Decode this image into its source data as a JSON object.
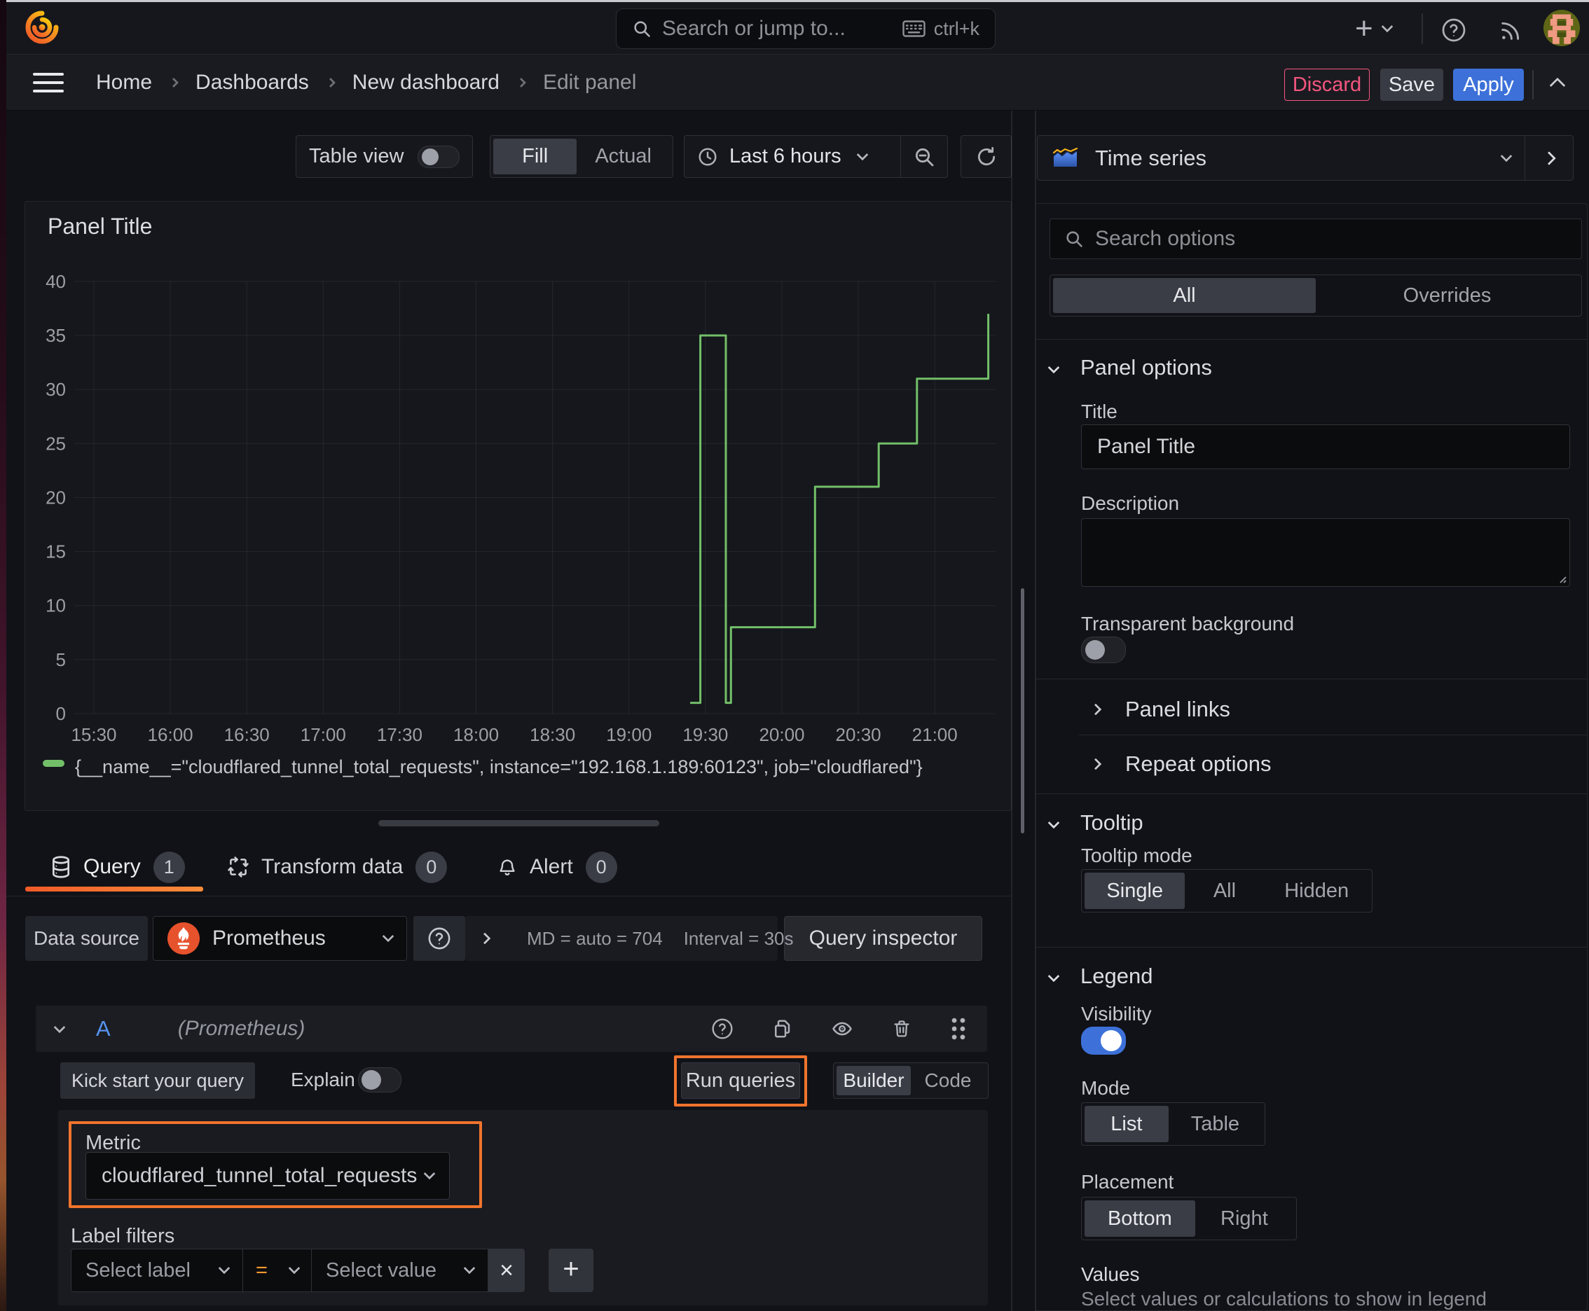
{
  "nav": {
    "search_placeholder": "Search or jump to...",
    "shortcut": "ctrl+k",
    "plus": "+"
  },
  "breadcrumb": {
    "items": [
      "Home",
      "Dashboards",
      "New dashboard",
      "Edit panel"
    ],
    "discard": "Discard",
    "save": "Save",
    "apply": "Apply"
  },
  "toolbar": {
    "table_view": "Table view",
    "fill": "Fill",
    "actual": "Actual",
    "time_range": "Last 6 hours"
  },
  "panel": {
    "title": "Panel Title"
  },
  "chart_data": {
    "type": "line",
    "interpolation": "step-after",
    "title": "Panel Title",
    "xlabel": "",
    "ylabel": "",
    "ylim": [
      0,
      40
    ],
    "x_range": [
      "15:30",
      "21:30"
    ],
    "x_ticks": [
      "15:30",
      "16:00",
      "16:30",
      "17:00",
      "17:30",
      "18:00",
      "18:30",
      "19:00",
      "19:30",
      "20:00",
      "20:30",
      "21:00"
    ],
    "y_ticks": [
      0,
      5,
      10,
      15,
      20,
      25,
      30,
      35,
      40
    ],
    "grid": true,
    "legend_position": "bottom",
    "series": [
      {
        "name": "{__name__=\"cloudflared_tunnel_total_requests\", instance=\"192.168.1.189:60123\", job=\"cloudflared\"}",
        "color": "#73bf69",
        "points": [
          [
            "19:24",
            1
          ],
          [
            "19:28",
            35
          ],
          [
            "19:38",
            1
          ],
          [
            "19:40",
            8
          ],
          [
            "20:13",
            21
          ],
          [
            "20:38",
            25
          ],
          [
            "20:53",
            31
          ],
          [
            "21:21",
            37
          ]
        ]
      }
    ]
  },
  "tabs": {
    "query": "Query",
    "query_count": "1",
    "transform": "Transform data",
    "transform_count": "0",
    "alert": "Alert",
    "alert_count": "0"
  },
  "datasource": {
    "label": "Data source",
    "name": "Prometheus",
    "stats_md": "MD = auto = 704",
    "stats_interval": "Interval = 30s",
    "inspector": "Query inspector"
  },
  "query": {
    "ref_id": "A",
    "ds_hint": "(Prometheus)",
    "kick_start": "Kick start your query",
    "explain": "Explain",
    "run": "Run queries",
    "builder": "Builder",
    "code": "Code",
    "metric_label": "Metric",
    "metric_value": "cloudflared_tunnel_total_requests",
    "label_filters": "Label filters",
    "select_label": "Select label",
    "operator": "=",
    "select_value": "Select value",
    "remove": "×",
    "add": "+"
  },
  "options": {
    "viz": "Time series",
    "search_placeholder": "Search options",
    "tab_all": "All",
    "tab_overrides": "Overrides",
    "panel_options": "Panel options",
    "title_label": "Title",
    "title_value": "Panel Title",
    "description_label": "Description",
    "transparent": "Transparent background",
    "panel_links": "Panel links",
    "repeat_options": "Repeat options",
    "tooltip": "Tooltip",
    "tooltip_mode": "Tooltip mode",
    "tooltip_opts": [
      "Single",
      "All",
      "Hidden"
    ],
    "legend": "Legend",
    "visibility": "Visibility",
    "mode": "Mode",
    "mode_opts": [
      "List",
      "Table"
    ],
    "placement": "Placement",
    "placement_opts": [
      "Bottom",
      "Right"
    ],
    "values_label": "Values",
    "values_hint": "Select values or calculations to show in legend"
  },
  "colors": {
    "accent_blue": "#3d71d9",
    "danger_pink": "#f4567f",
    "annotation_orange": "#f1742d",
    "series_green": "#73bf69",
    "prometheus_orange": "#e6522c"
  }
}
